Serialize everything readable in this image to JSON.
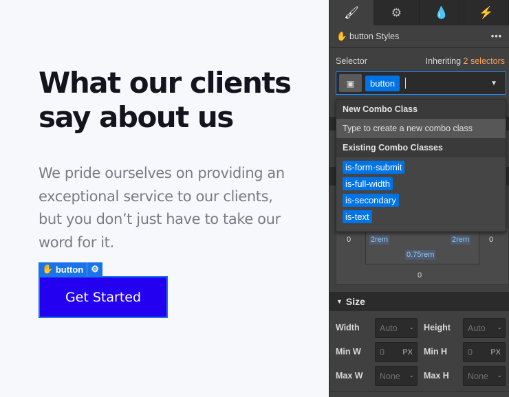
{
  "canvas": {
    "heading": "What our clients say about us",
    "lead": "We pride ourselves on providing an exceptional service to our clients, but you don’t just have to take our word for it.",
    "element_tag": "button",
    "cta": "Get Started"
  },
  "panel": {
    "tabs": [
      {
        "icon": "brush-icon",
        "glyph": "🖌"
      },
      {
        "icon": "gear-icon",
        "glyph": "⚙"
      },
      {
        "icon": "drops-icon",
        "glyph": "💧"
      },
      {
        "icon": "bolt-icon",
        "glyph": "⚡"
      }
    ],
    "header": {
      "title": "button Styles",
      "more": "•••"
    },
    "selector": {
      "label": "Selector",
      "inheriting": "Inheriting",
      "inherit_count": "2 selectors",
      "chip": "button"
    },
    "menu": {
      "new_header": "New Combo Class",
      "new_hint": "Type to create a new combo class",
      "existing_header": "Existing Combo Classes",
      "classes": [
        "is-form-submit",
        "is-full-width",
        "is-secondary",
        "is-text"
      ]
    },
    "box": {
      "left": "0",
      "pad_left": "2rem",
      "pad_right": "2rem",
      "right": "0",
      "pad_bottom": "0.75rem",
      "bottom": "0"
    },
    "size": {
      "title": "Size",
      "width_label": "Width",
      "width": "Auto",
      "width_unit": "-",
      "height_label": "Height",
      "height": "Auto",
      "height_unit": "-",
      "minw_label": "Min W",
      "minw": "0",
      "minw_unit": "PX",
      "minh_label": "Min H",
      "minh": "0",
      "minh_unit": "PX",
      "maxw_label": "Max W",
      "maxw": "None",
      "maxw_unit": "-",
      "maxh_label": "Max H",
      "maxh": "None",
      "maxh_unit": "-"
    },
    "colors": {
      "accent": "#0073e6",
      "cta": "#2400f0",
      "orange": "#f5a25d"
    }
  }
}
